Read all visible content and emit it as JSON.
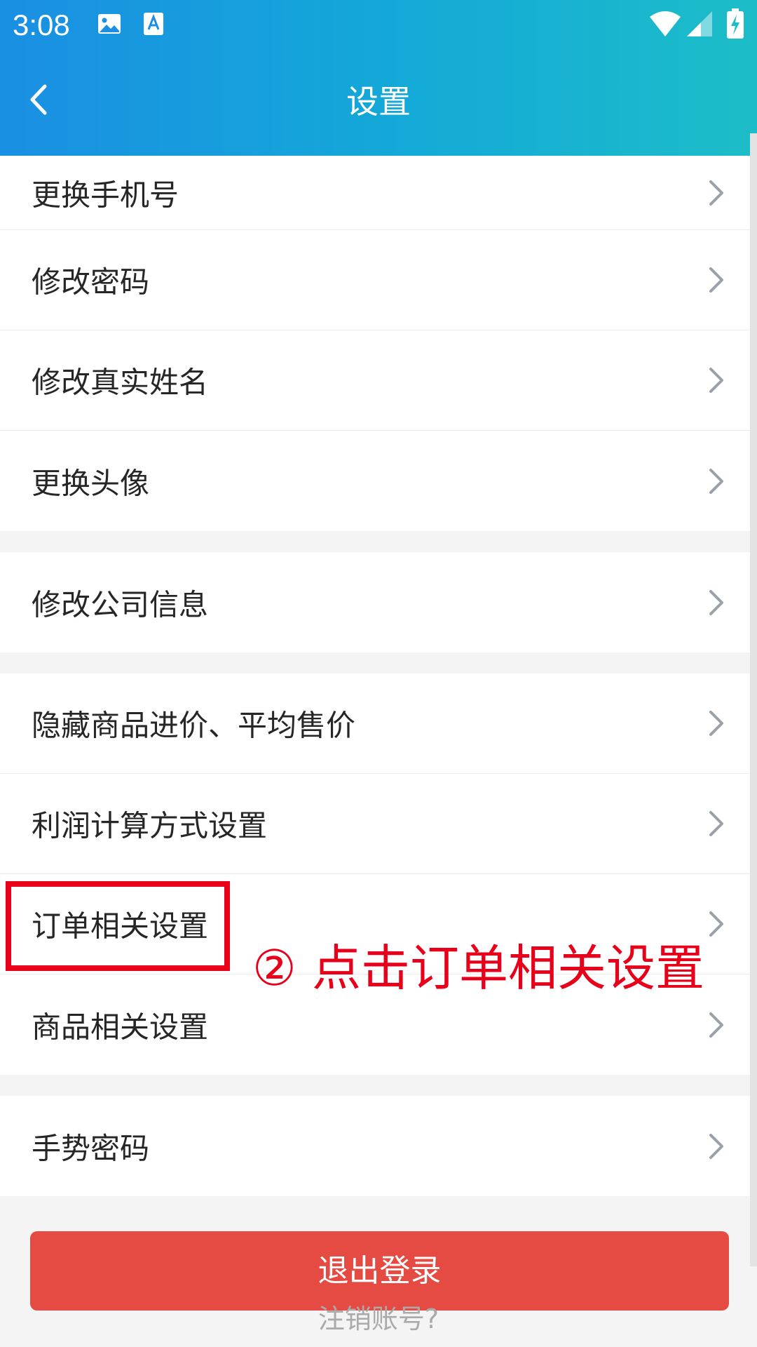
{
  "status_bar": {
    "time": "3:08",
    "icons": [
      "image-icon",
      "text-icon",
      "wifi-icon",
      "signal-icon",
      "battery-icon"
    ]
  },
  "header": {
    "title": "设置",
    "back_icon": "chevron-left-icon"
  },
  "groups": [
    {
      "items": [
        {
          "label": "更换手机号"
        },
        {
          "label": "修改密码"
        },
        {
          "label": "修改真实姓名"
        },
        {
          "label": "更换头像"
        }
      ]
    },
    {
      "items": [
        {
          "label": "修改公司信息"
        }
      ]
    },
    {
      "items": [
        {
          "label": "隐藏商品进价、平均售价"
        },
        {
          "label": "利润计算方式设置"
        },
        {
          "label": "订单相关设置"
        },
        {
          "label": "商品相关设置"
        }
      ]
    },
    {
      "items": [
        {
          "label": "手势密码"
        }
      ]
    }
  ],
  "logout_button": "退出登录",
  "cancel_account_link": "注销账号?",
  "annotation": {
    "text": "② 点击订单相关设置"
  },
  "colors": {
    "header_gradient_start": "#1a8fe3",
    "header_gradient_end": "#1cbdc8",
    "logout_red": "#e64b43",
    "annotation_red": "#e8001a"
  }
}
